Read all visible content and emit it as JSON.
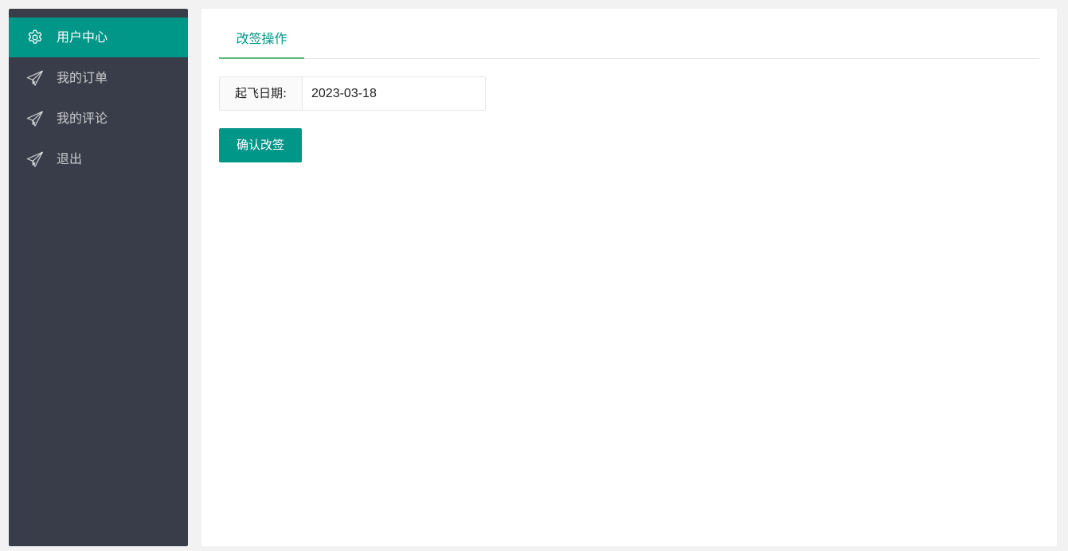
{
  "sidebar": {
    "items": [
      {
        "label": "用户中心",
        "icon": "gear-icon",
        "active": true
      },
      {
        "label": "我的订单",
        "icon": "paper-plane-icon",
        "active": false
      },
      {
        "label": "我的评论",
        "icon": "paper-plane-icon",
        "active": false
      },
      {
        "label": "退出",
        "icon": "paper-plane-icon",
        "active": false
      }
    ],
    "active_color": "#009688",
    "background_color": "#393d49"
  },
  "main": {
    "tabs": [
      {
        "label": "改签操作",
        "active": true
      }
    ],
    "form": {
      "date_label": "起飞日期:",
      "date_value": "2023-03-18"
    },
    "confirm_label": "确认改签"
  }
}
